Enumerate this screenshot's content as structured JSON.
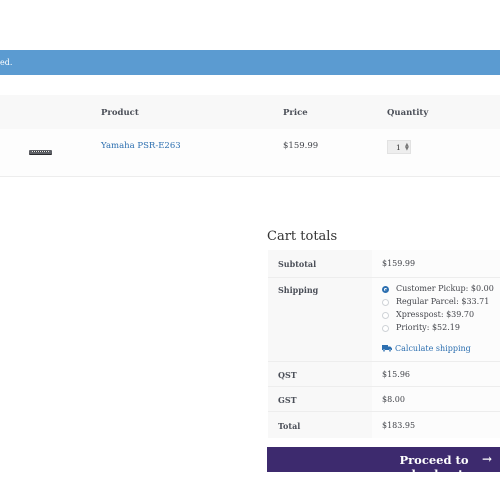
{
  "notice": {
    "text": "ed."
  },
  "cart": {
    "headers": {
      "product": "Product",
      "price": "Price",
      "quantity": "Quantity"
    },
    "item": {
      "thumbnail_icon": "keyboard-thumbnail",
      "name": "Yamaha PSR-E263",
      "price": "$159.99",
      "quantity": "1"
    }
  },
  "totals": {
    "title": "Cart totals",
    "subtotal_label": "Subtotal",
    "subtotal_value": "$159.99",
    "shipping_label": "Shipping",
    "shipping_options": [
      {
        "label": "Customer Pickup: $0.00",
        "selected": true
      },
      {
        "label": "Regular Parcel: $33.71",
        "selected": false
      },
      {
        "label": "Xpresspost: $39.70",
        "selected": false
      },
      {
        "label": "Priority: $52.19",
        "selected": false
      }
    ],
    "calculate_shipping": "Calculate shipping",
    "qst_label": "QST",
    "qst_value": "$15.96",
    "gst_label": "GST",
    "gst_value": "$8.00",
    "total_label": "Total",
    "total_value": "$183.95"
  },
  "checkout": {
    "label": "Proceed to checkout",
    "arrow": "→"
  },
  "colors": {
    "notice_bg": "#5b9bd1",
    "link": "#2c6fb0",
    "checkout_bg": "#3d2a6e"
  }
}
